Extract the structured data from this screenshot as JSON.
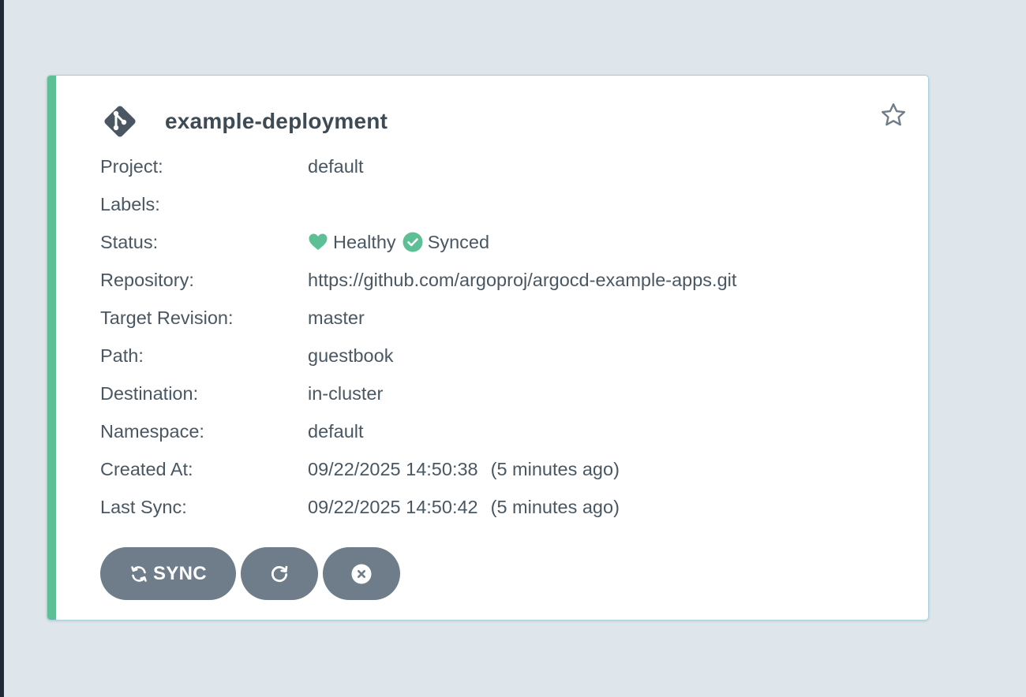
{
  "app": {
    "name": "example-deployment",
    "health_color": "#5cbf95"
  },
  "fields": {
    "project": {
      "label": "Project:",
      "value": "default"
    },
    "labels": {
      "label": "Labels:",
      "value": ""
    },
    "status": {
      "label": "Status:",
      "health": "Healthy",
      "health_icon": "heart-icon",
      "sync": "Synced",
      "sync_icon": "check-circle-icon"
    },
    "repository": {
      "label": "Repository:",
      "value": "https://github.com/argoproj/argocd-example-apps.git"
    },
    "target_revision": {
      "label": "Target Revision:",
      "value": "master"
    },
    "path": {
      "label": "Path:",
      "value": "guestbook"
    },
    "destination": {
      "label": "Destination:",
      "value": "in-cluster"
    },
    "namespace": {
      "label": "Namespace:",
      "value": "default"
    },
    "created_at": {
      "label": "Created At:",
      "date": "09/22/2025 14:50:38",
      "ago": "(5 minutes ago)"
    },
    "last_sync": {
      "label": "Last Sync:",
      "date": "09/22/2025 14:50:42",
      "ago": "(5 minutes ago)"
    }
  },
  "actions": {
    "sync_label": "SYNC",
    "sync_icon": "sync-icon",
    "refresh_icon": "refresh-icon",
    "delete_icon": "close-circle-icon"
  },
  "colors": {
    "background": "#dee6eb",
    "button": "#6e7d89",
    "healthy": "#5cbf95",
    "text": "#495763"
  }
}
